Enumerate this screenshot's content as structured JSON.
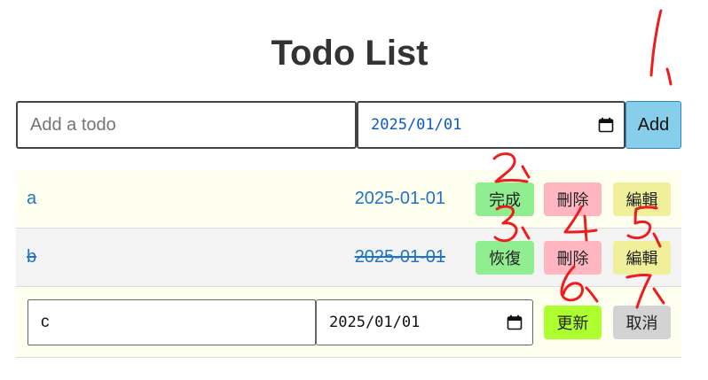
{
  "header": {
    "title": "Todo List"
  },
  "add_form": {
    "placeholder": "Add a todo",
    "date_value": "2025/01/01",
    "add_label": "Add"
  },
  "todos": [
    {
      "text": "a",
      "date": "2025-01-01",
      "completed": false,
      "toggle_label": "完成",
      "delete_label": "刪除",
      "edit_label": "編輯"
    },
    {
      "text": "b",
      "date": "2025-01-01",
      "completed": true,
      "toggle_label": "恢復",
      "delete_label": "刪除",
      "edit_label": "編輯"
    }
  ],
  "editing": {
    "text_value": "c",
    "date_value": "2025/01/01",
    "update_label": "更新",
    "cancel_label": "取消"
  },
  "annotations": [
    "1",
    "2",
    "3",
    "4",
    "5",
    "6",
    "7"
  ],
  "colors": {
    "add_button": "#87ceeb",
    "complete_button": "#90ee90",
    "delete_button": "#ffb6c1",
    "edit_button": "#f0f09a",
    "update_button": "#adff2f",
    "cancel_button": "#d3d3d3",
    "link_text": "#1f73c7",
    "annotation": "#ee1c1c"
  }
}
